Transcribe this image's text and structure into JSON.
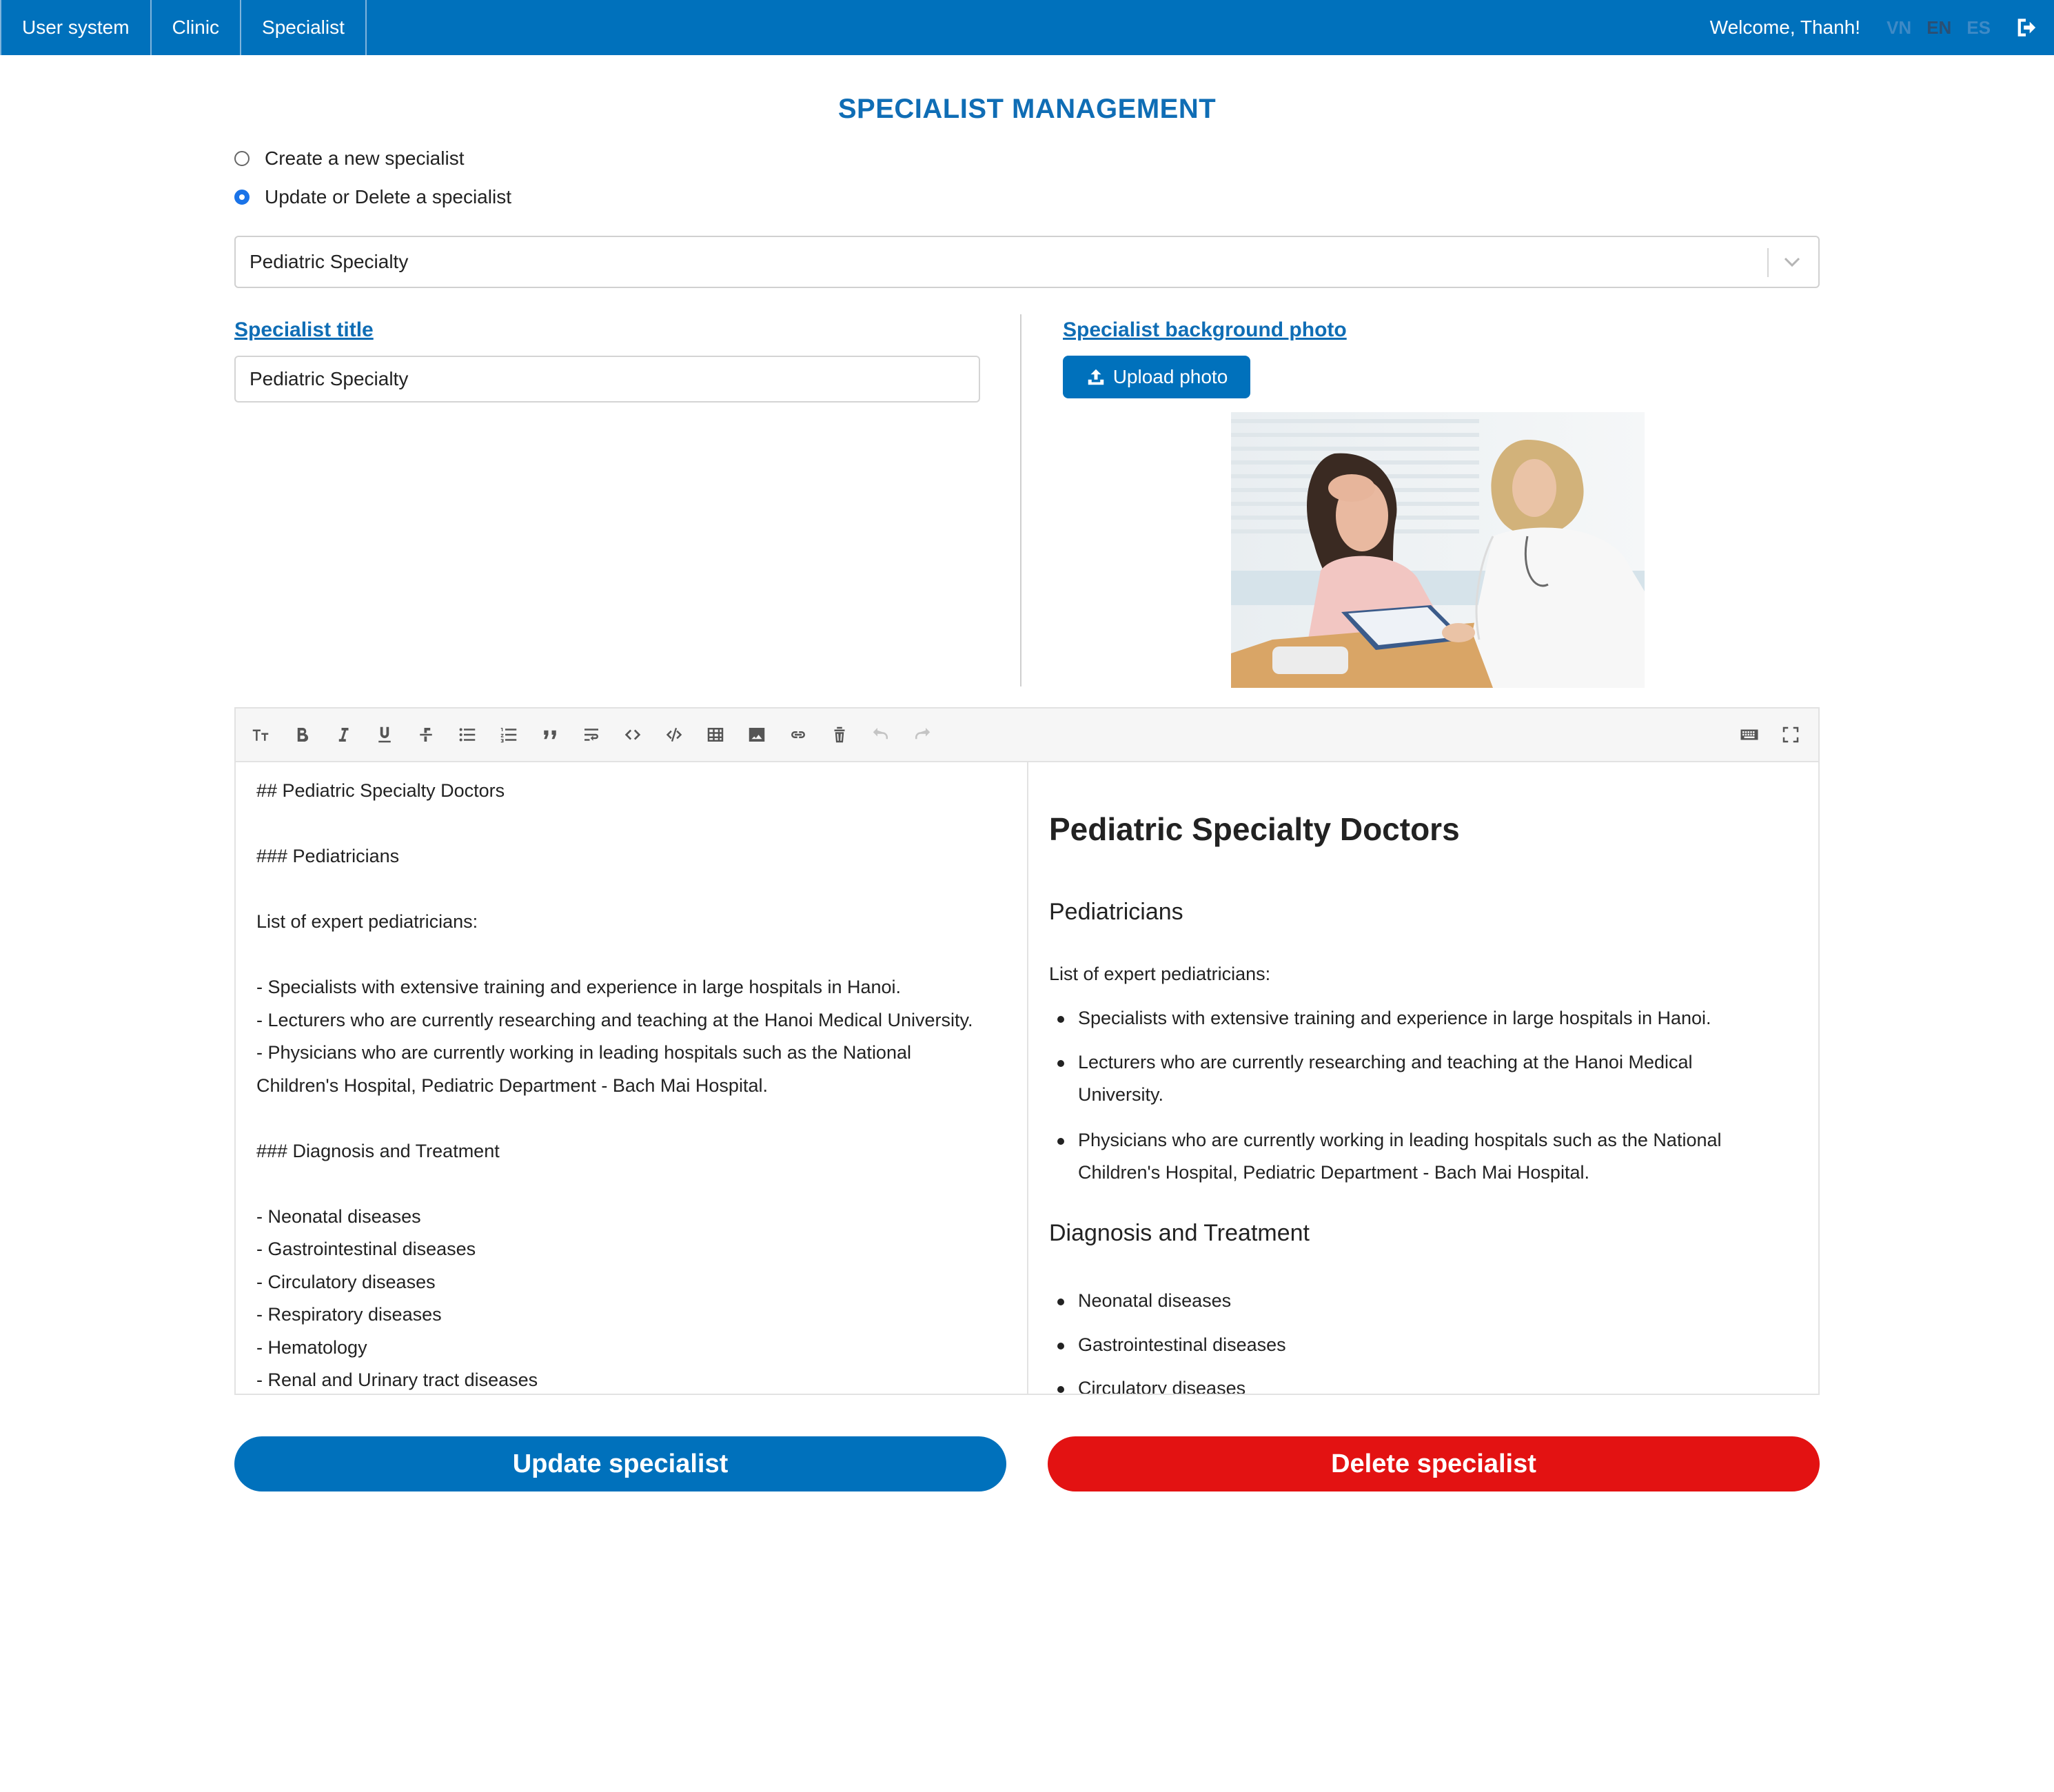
{
  "nav": {
    "items": [
      "User system",
      "Clinic",
      "Specialist"
    ],
    "welcome": "Welcome, Thanh!",
    "languages": [
      "VN",
      "EN",
      "ES"
    ],
    "active_language": "EN"
  },
  "page": {
    "title": "SPECIALIST MANAGEMENT"
  },
  "mode": {
    "options": [
      "Create a new specialist",
      "Update or Delete a specialist"
    ],
    "selected": "Update or Delete a specialist"
  },
  "specialist_select": {
    "value": "Pediatric Specialty"
  },
  "form": {
    "title_label": "Specialist title",
    "title_value": "Pediatric Specialty",
    "photo_label": "Specialist background photo",
    "upload_label": "Upload photo"
  },
  "editor": {
    "toolbar_icons": [
      "font-size-icon",
      "bold-icon",
      "italic-icon",
      "underline-icon",
      "strikethrough-icon",
      "unordered-list-icon",
      "ordered-list-icon",
      "quote-icon",
      "wrap-icon",
      "code-icon",
      "code-block-icon",
      "table-icon",
      "image-icon",
      "link-icon",
      "clear-icon",
      "undo-icon",
      "redo-icon",
      "keyboard-icon",
      "fullscreen-icon"
    ],
    "source_lines": [
      "## Pediatric Specialty Doctors",
      "",
      "### Pediatricians",
      "",
      "List of expert pediatricians:",
      "",
      "- Specialists with extensive training and experience in large hospitals in Hanoi.",
      "- Lecturers who are currently researching and teaching at the Hanoi Medical University.",
      "- Physicians who are currently working in leading hospitals such as the National",
      "Children's Hospital, Pediatric Department - Bach Mai Hospital.",
      "",
      "### Diagnosis and Treatment",
      "",
      "- Neonatal diseases",
      "- Gastrointestinal diseases",
      "- Circulatory diseases",
      "- Respiratory diseases",
      "- Hematology",
      "- Renal and Urinary tract diseases"
    ],
    "preview": {
      "h2": "Pediatric Specialty Doctors",
      "h3_1": "Pediatricians",
      "intro": "List of expert pediatricians:",
      "list1": [
        "Specialists with extensive training and experience in large hospitals in Hanoi.",
        "Lecturers who are currently researching and teaching at the Hanoi Medical University.",
        "Physicians who are currently working in leading hospitals such as the National Children's Hospital, Pediatric Department - Bach Mai Hospital."
      ],
      "h3_2": "Diagnosis and Treatment",
      "list2": [
        "Neonatal diseases",
        "Gastrointestinal diseases",
        "Circulatory diseases"
      ]
    }
  },
  "actions": {
    "update": "Update specialist",
    "delete": "Delete specialist"
  },
  "colors": {
    "primary": "#0071bc",
    "danger": "#e31212",
    "title": "#0f6db5"
  }
}
